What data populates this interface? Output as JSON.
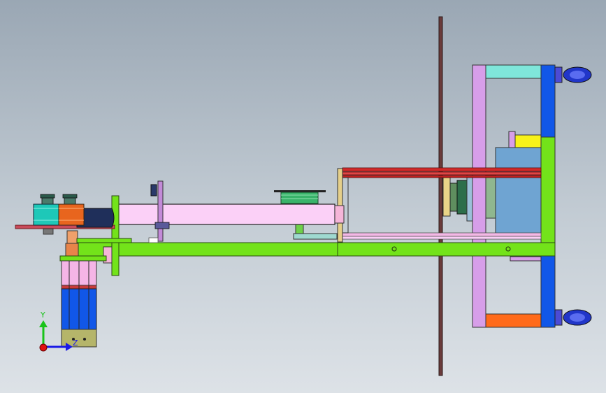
{
  "view": {
    "background_top": "#9aa7b4",
    "background_bottom": "#dde2e7"
  },
  "triad": {
    "y_label": "Y",
    "z_label": "Z",
    "y_color": "#19c319",
    "z_color": "#1a1ae6",
    "origin_color": "#e01010"
  },
  "colors": {
    "frame_green": "#73e31a",
    "beam_pink": "#fbd0f7",
    "frame_violet": "#d79ee9",
    "cyan_bar": "#7fe6da",
    "blue_column": "#1157e8",
    "orange_bar": "#ff6a1a",
    "yellow_block": "#f7f21a",
    "steel_blue_box": "#6fa4d2",
    "red_rails": "#d12a2a",
    "motor_blue": "#2136c9",
    "teal_drum": "#1ec8b8",
    "orange_drum": "#e8651e"
  }
}
